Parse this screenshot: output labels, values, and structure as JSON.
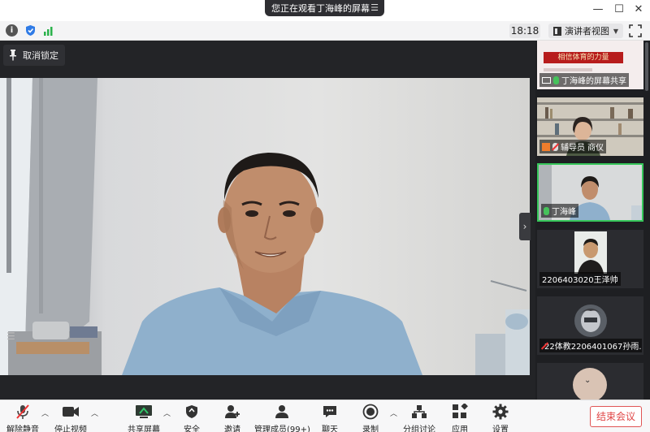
{
  "window": {
    "share_banner": "您正在观看丁海峰的屏幕",
    "banner_menu_icon": "list-icon",
    "controls": [
      "minimize-icon",
      "maximize-icon",
      "close-icon"
    ]
  },
  "infobar": {
    "icons": [
      "info-icon",
      "shield-icon",
      "signal-icon"
    ],
    "time": "18:18",
    "view_mode": "演讲者视图",
    "fullscreen_icon": "fullscreen-icon"
  },
  "stage": {
    "lock_label": "取消锁定",
    "collapse_glyph": "›",
    "handle_glyph": "☰"
  },
  "gallery": {
    "tiles": [
      {
        "label": "丁海峰的屏幕共享",
        "slide_text": "相信体育的力量"
      },
      {
        "label": "辅导员 商仪"
      },
      {
        "label": "丁海峰"
      },
      {
        "label": "2206403020王泽帅"
      },
      {
        "label": "22体教2206401067孙雨..."
      }
    ]
  },
  "toolbar": {
    "items": [
      {
        "id": "unmute",
        "label": "解除静音",
        "icon": "mic-off-icon"
      },
      {
        "id": "video",
        "label": "停止视频",
        "icon": "video-camera-icon"
      },
      {
        "id": "share",
        "label": "共享屏幕",
        "icon": "share-screen-icon"
      },
      {
        "id": "security",
        "label": "安全",
        "icon": "shield-icon"
      },
      {
        "id": "invite",
        "label": "邀请",
        "icon": "invite-icon"
      },
      {
        "id": "members",
        "label": "管理成员(99+)",
        "icon": "members-icon"
      },
      {
        "id": "chat",
        "label": "聊天",
        "icon": "chat-icon"
      },
      {
        "id": "record",
        "label": "录制",
        "icon": "record-icon"
      },
      {
        "id": "breakout",
        "label": "分组讨论",
        "icon": "breakout-icon"
      },
      {
        "id": "apps",
        "label": "应用",
        "icon": "apps-icon"
      },
      {
        "id": "settings",
        "label": "设置",
        "icon": "gear-icon"
      }
    ],
    "end_label": "结束会议"
  },
  "colors": {
    "active_border": "#36c75a",
    "end_red": "#e04545",
    "stage_bg": "#232427"
  }
}
